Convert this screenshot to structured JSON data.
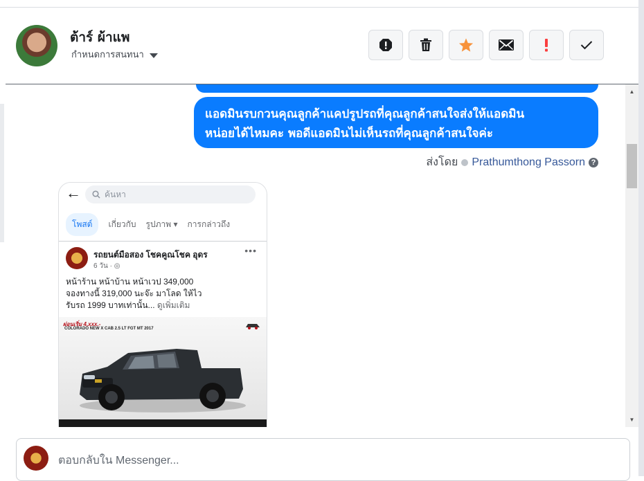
{
  "header": {
    "contact_name": "ต้าร์ ผ้าแพ",
    "assign_label": "กำหนดการสนทนา",
    "actions": [
      {
        "name": "spam-icon",
        "color": "#1c1e21"
      },
      {
        "name": "trash-icon",
        "color": "#1c1e21"
      },
      {
        "name": "star-icon",
        "color": "#f7923b"
      },
      {
        "name": "mail-icon",
        "color": "#1c1e21"
      },
      {
        "name": "exclamation-icon",
        "color": "#fa3e3e"
      },
      {
        "name": "check-icon",
        "color": "#1c1e21"
      }
    ]
  },
  "conversation": {
    "message_line1": "แอดมินรบกวนคุณลูกค้าแคปรูปรถที่คุณลูกค้าสนใจส่งให้แอดมิน",
    "message_line2": "หน่อยได้ไหมคะ  พอดีแอดมินไม่เห็นรถที่คุณลูกค้าสนใจค่ะ",
    "sent_by_label": "ส่งโดย",
    "sent_by_name": "Prathumthong Passorn",
    "bubble_color": "#0a7cff"
  },
  "shared_screenshot": {
    "search_placeholder": "ค้นหา",
    "tabs": [
      "โพสต์",
      "เกี่ยวกับ",
      "รูปภาพ",
      "การกล่าวถึง"
    ],
    "page_name": "รถยนต์มือสอง โชคคูณโชค อุดร",
    "post_meta": "6 วัน ·",
    "post_line1": "หน้าร้าน หน้าบ้าน หน้าเวป 349,000",
    "post_line2": "จองทางนี้ 319,000 นะจ๊ะ มาโลด ให้ไว",
    "post_line3": "รับรถ 1999 บาทเท่านั้น...",
    "see_more": "ดูเพิ่มเติม",
    "banner_text": "ผ่อนเริ่ม 4,xxx.-",
    "model_text": "COLORADO NEW X CAB 2.5 LT FGT MT 2017"
  },
  "composer": {
    "placeholder": "ตอบกลับใน Messenger..."
  }
}
